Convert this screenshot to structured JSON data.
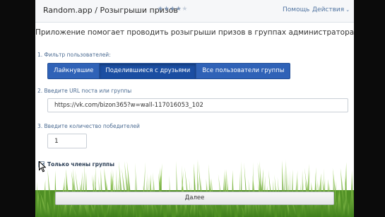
{
  "header": {
    "app_title": "Random.app / Розыгрыши призов",
    "rating": {
      "filled": 4,
      "total": 5
    },
    "help_label": "Помощь",
    "actions_label": "Действия"
  },
  "intro_text": "Приложение помогает проводить розыгрыши призов в группах администраторам групп.",
  "steps": {
    "filter_label": "1. Фильтр пользователей:",
    "filter_buttons": [
      "Лайкнувшие",
      "Поделившиеся с друзьями",
      "Все пользователи группы"
    ],
    "filter_active": "Поделившиеся с друзьями",
    "url_label": "2. Введите URL поста или группы",
    "url_value": "https://vk.com/bizon365?w=wall-117016053_102",
    "count_label": "3. Введите количество победителей",
    "count_value": "1"
  },
  "members_only": {
    "label": "Только члены группы",
    "checked": true
  },
  "submit_label": "Далее",
  "colors": {
    "accent": "#2f62b7",
    "link": "#4f73a0",
    "grass": "#6fae2f",
    "background": "#0b0b0b"
  }
}
